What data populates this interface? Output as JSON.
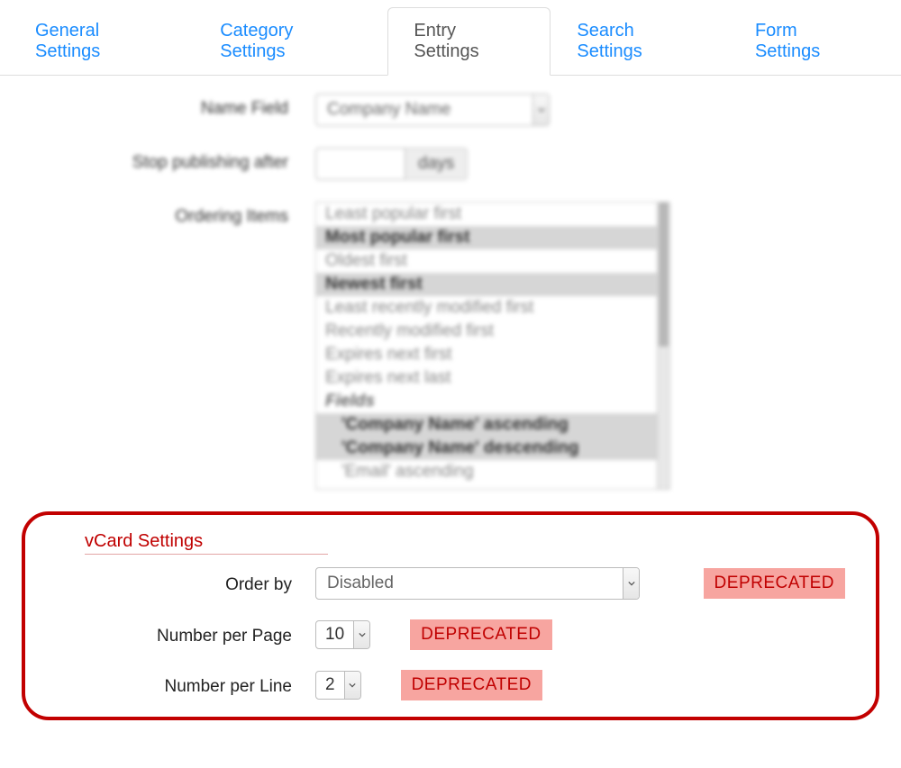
{
  "tabs": {
    "general": "General Settings",
    "category": "Category Settings",
    "entry": "Entry Settings",
    "search": "Search Settings",
    "form": "Form Settings"
  },
  "nameField": {
    "label": "Name Field",
    "value": "Company Name"
  },
  "stopPublishing": {
    "label": "Stop publishing after",
    "unit": "days"
  },
  "ordering": {
    "label": "Ordering Items",
    "items": [
      {
        "text": "Least popular first",
        "selected": false
      },
      {
        "text": "Most popular first",
        "selected": true
      },
      {
        "text": "Oldest first",
        "selected": false
      },
      {
        "text": "Newest first",
        "selected": true
      },
      {
        "text": "Least recently modified first",
        "selected": false
      },
      {
        "text": "Recently modified first",
        "selected": false
      },
      {
        "text": "Expires next first",
        "selected": false
      },
      {
        "text": "Expires next last",
        "selected": false
      }
    ],
    "group": "Fields",
    "groupItems": [
      {
        "text": "'Company Name' ascending",
        "selected": true
      },
      {
        "text": "'Company Name' descending",
        "selected": true
      },
      {
        "text": "'Email' ascending",
        "selected": false
      }
    ]
  },
  "vcard": {
    "heading": "vCard Settings",
    "orderBy": {
      "label": "Order by",
      "value": "Disabled"
    },
    "perPage": {
      "label": "Number per Page",
      "value": "10"
    },
    "perLine": {
      "label": "Number per Line",
      "value": "2"
    },
    "deprecated": "DEPRECATED"
  }
}
